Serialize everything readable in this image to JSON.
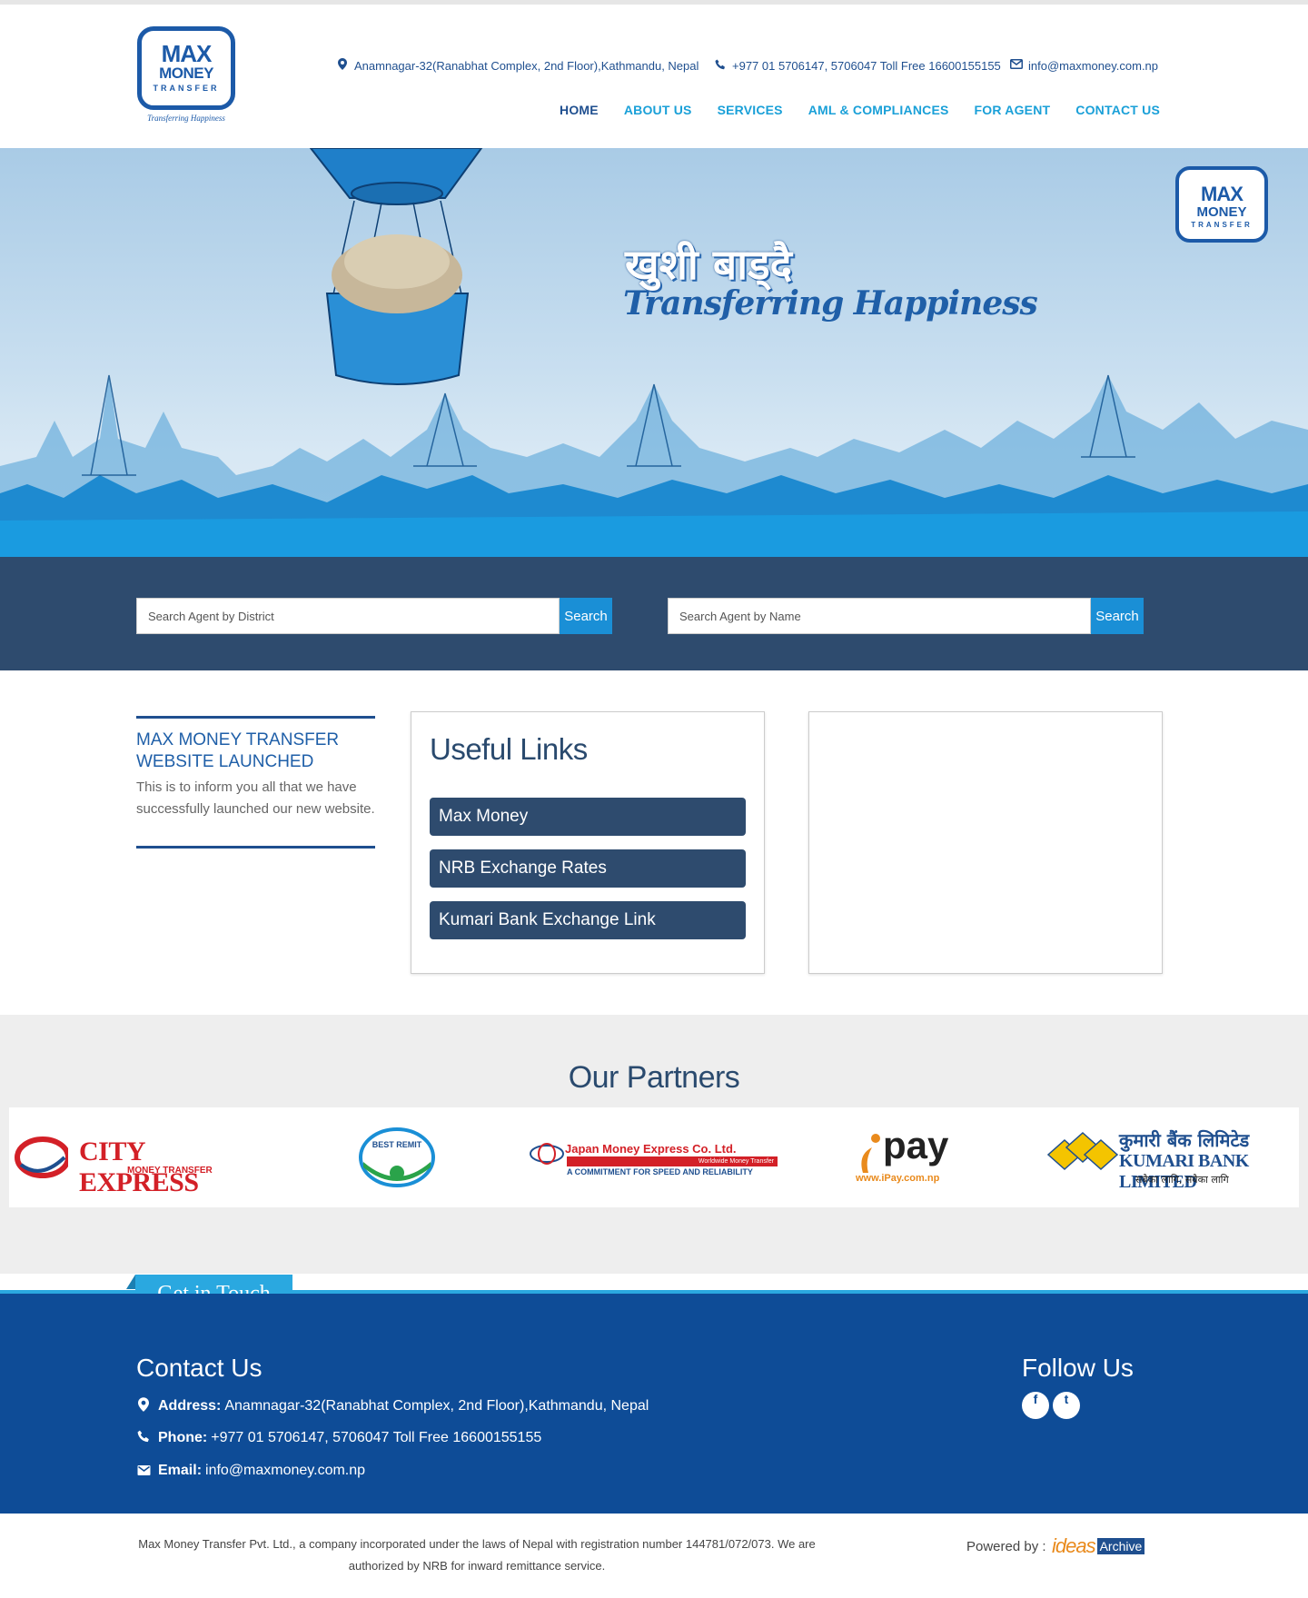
{
  "header": {
    "logo": {
      "max": "MAX",
      "money": "MONEY",
      "transfer": "TRANSFER",
      "tagline": "Transferring Happiness"
    },
    "address": "Anamnagar-32(Ranabhat Complex, 2nd Floor),Kathmandu, Nepal",
    "phone": "+977 01 5706147, 5706047 Toll Free 16600155155",
    "email": "info@maxmoney.com.np",
    "icons": {
      "address": "map-marker-icon",
      "phone": "phone-icon",
      "email": "envelope-icon"
    }
  },
  "nav": {
    "items": [
      {
        "label": "HOME",
        "active": true
      },
      {
        "label": "ABOUT US"
      },
      {
        "label": "SERVICES"
      },
      {
        "label": "AML & COMPLIANCES"
      },
      {
        "label": "FOR AGENT"
      },
      {
        "label": "CONTACT US"
      }
    ]
  },
  "hero": {
    "title_np": "खुशी बाड्दै",
    "title_en": "Transferring Happiness",
    "badge": {
      "max": "MAX",
      "money": "MONEY",
      "transfer": "TRANSFER"
    }
  },
  "search": {
    "district_placeholder": "Search Agent by District",
    "name_placeholder": "Search Agent by Name",
    "button_label": "Search"
  },
  "news": {
    "title": "MAX MONEY TRANSFER WEBSITE LAUNCHED",
    "body": "This is to inform you all that we have successfully launched our new website."
  },
  "useful_links": {
    "title": "Useful Links",
    "items": [
      {
        "label": "Max Money"
      },
      {
        "label": "NRB Exchange Rates"
      },
      {
        "label": "Kumari Bank Exchange Link"
      }
    ]
  },
  "partners": {
    "title": "Our Partners",
    "items": [
      {
        "name": "CITY EXPRESS",
        "sub": "MONEY TRANSFER"
      },
      {
        "name": "BEST REMIT"
      },
      {
        "name": "Japan Money Express Co. Ltd.",
        "sub": "A COMMITMENT FOR SPEED AND RELIABILITY",
        "small": "Worldwide Money Transfer"
      },
      {
        "name": "pay",
        "sub": "www.iPay.com.np"
      },
      {
        "name": "कुमारी बैंक लिमिटेड",
        "sub": "KUMARI BANK LIMITED",
        "tag": "सबैका लागि, सबैका लागि"
      }
    ]
  },
  "footer": {
    "tab": "Get in Touch",
    "contact_title": "Contact Us",
    "address_label": "Address:",
    "address": "Anamnagar-32(Ranabhat Complex, 2nd Floor),Kathmandu, Nepal",
    "phone_label": "Phone:",
    "phone": "+977 01 5706147, 5706047 Toll Free 16600155155",
    "email_label": "Email:",
    "email": "info@maxmoney.com.np",
    "follow_title": "Follow Us",
    "social": [
      {
        "icon": "facebook-icon",
        "glyph": "f"
      },
      {
        "icon": "twitter-icon",
        "glyph": "t"
      }
    ]
  },
  "bottom": {
    "legal": "Max Money Transfer Pvt. Ltd., a company incorporated under the laws of Nepal with registration number 144781/072/073. We are authorized by NRB for inward remittance service.",
    "powered_by": "Powered by :",
    "ideas": "ideas",
    "archive": "Archive"
  },
  "colors": {
    "primary": "#1f4f8f",
    "accent": "#1aa0d8",
    "band": "#2e4b6e",
    "footer": "#0e4c97",
    "button": "#1a8fd6"
  }
}
